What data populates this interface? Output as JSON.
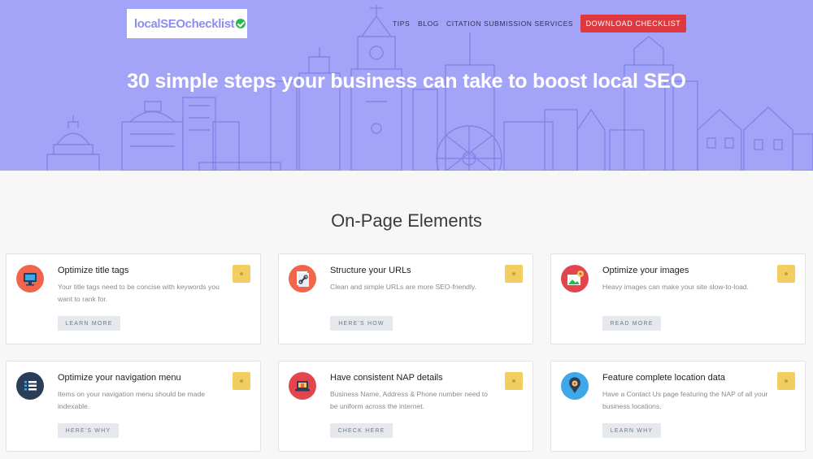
{
  "header": {
    "logo_text": "localSEOchecklist",
    "nav": [
      "TIPS",
      "BLOG",
      "CITATION SUBMISSION SERVICES"
    ],
    "cta_label": "DOWNLOAD CHECKLIST",
    "headline": "30 simple steps your business can take to boost local SEO"
  },
  "colors": {
    "hero_bg": "#a3a4f7",
    "cta_bg": "#e0383f",
    "bookmark": "#f1cd62"
  },
  "section": {
    "title": "On-Page Elements",
    "cards": [
      {
        "title": "Optimize title tags",
        "desc": "Your title tags need to be concise with keywords you want to rank for.",
        "button": "LEARN MORE",
        "icon": "code-monitor-icon",
        "icon_color": "#f0654b"
      },
      {
        "title": "Structure your URLs",
        "desc": "Clean and simple URLs are more SEO-friendly.",
        "button": "HERE'S HOW",
        "icon": "link-document-icon",
        "icon_color": "#f0654b"
      },
      {
        "title": "Optimize your images",
        "desc": "Heavy images can make your site slow-to-load.",
        "button": "READ MORE",
        "icon": "image-gear-icon",
        "icon_color": "#e2464c"
      },
      {
        "title": "Optimize your navigation menu",
        "desc": "Items on your navigation menu should be made indexable.",
        "button": "HERE'S WHY",
        "icon": "list-menu-icon",
        "icon_color": "#2b3d58"
      },
      {
        "title": "Have consistent NAP details",
        "desc": "Business Name, Address & Phone number need to be uniform across the internet.",
        "button": "CHECK HERE",
        "icon": "laptop-store-icon",
        "icon_color": "#e2464c"
      },
      {
        "title": "Feature complete location data",
        "desc": "Have a Contact Us page featuring the NAP of all your business locations.",
        "button": "LEARN WHY",
        "icon": "map-pin-icon",
        "icon_color": "#3ea8e8"
      }
    ]
  }
}
